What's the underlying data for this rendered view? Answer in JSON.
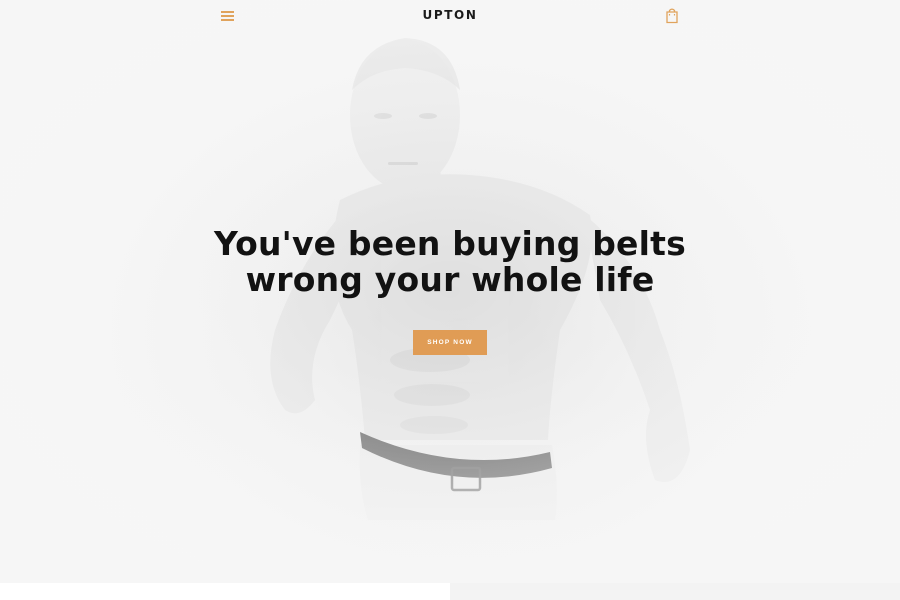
{
  "header": {
    "logo": "UPTON",
    "menu_icon": "hamburger-menu-icon",
    "cart_icon": "shopping-bag-icon"
  },
  "hero": {
    "headline_line1": "You've been buying belts",
    "headline_line2": "wrong your whole life",
    "cta_label": "SHOP NOW"
  },
  "colors": {
    "accent": "#e09c55",
    "headline": "#121212",
    "hero_background": "#ececec"
  }
}
